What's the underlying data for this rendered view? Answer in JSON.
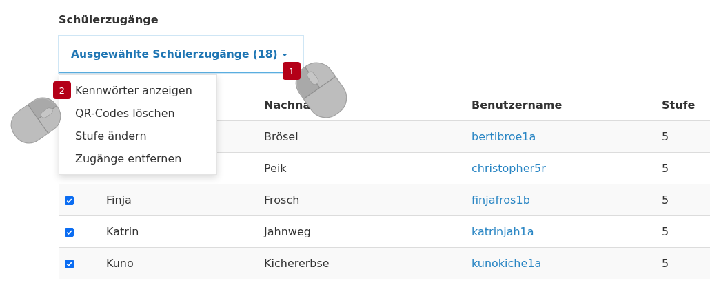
{
  "section": {
    "title": "Schülerzugänge"
  },
  "dropdown": {
    "label": "Ausgewählte Schülerzugänge (18)",
    "expanded": true,
    "items": [
      "Kennwörter anzeigen",
      "QR-Codes löschen",
      "Stufe ändern",
      "Zugänge entfernen"
    ]
  },
  "callouts": [
    {
      "number": "1"
    },
    {
      "number": "2"
    }
  ],
  "table": {
    "columns": [
      "Nachna",
      "Benutzername",
      "Stufe"
    ],
    "rows": [
      {
        "last_name": "Brösel",
        "username": "bertibroe1a",
        "stufe": "5"
      },
      {
        "last_name": "Peik",
        "username": "christopher5r",
        "stufe": "5"
      },
      {
        "checked": true,
        "first_name": "Finja",
        "last_name": "Frosch",
        "username": "finjafros1b",
        "stufe": "5"
      },
      {
        "checked": true,
        "first_name": "Katrin",
        "last_name": "Jahnweg",
        "username": "katrinjah1a",
        "stufe": "5"
      },
      {
        "checked": true,
        "first_name": "Kuno",
        "last_name": "Kichererbse",
        "username": "kunokiche1a",
        "stufe": "5"
      }
    ]
  }
}
